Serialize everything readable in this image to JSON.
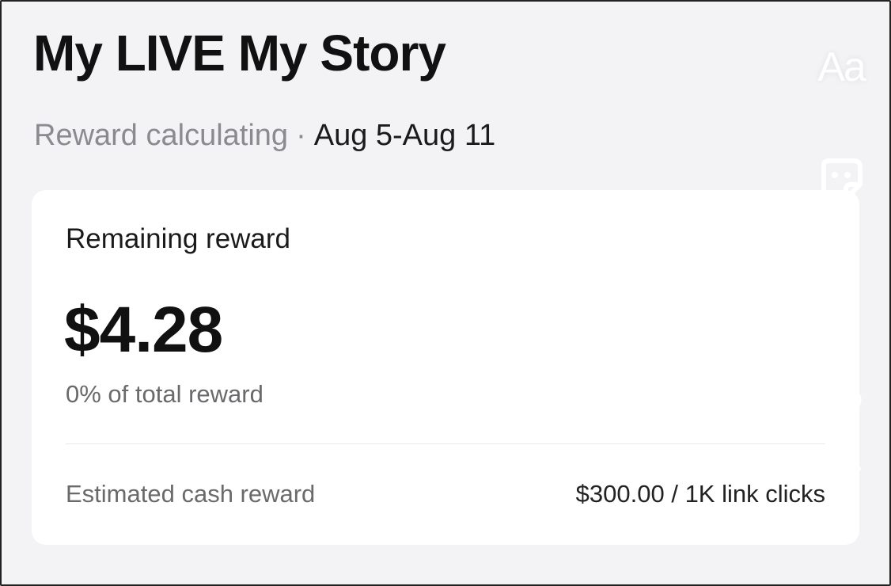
{
  "header": {
    "title": "My LIVE My Story",
    "status": "Reward calculating",
    "separator": "·",
    "date_range": "Aug 5-Aug 11"
  },
  "card": {
    "label": "Remaining reward",
    "amount": "$4.28",
    "percent_text": "0% of total reward",
    "estimate_label": "Estimated cash reward",
    "estimate_value": "$300.00 / 1K link clicks"
  },
  "toolbar": {
    "text_tool_label": "Aa",
    "icons": [
      "text-icon",
      "sticker-icon",
      "add-icon",
      "filter-icon",
      "chevron-down-icon"
    ]
  },
  "colors": {
    "background": "#f3f2f5",
    "card": "#ffffff",
    "muted_text": "#8b8b8f",
    "primary_text": "#111111"
  }
}
